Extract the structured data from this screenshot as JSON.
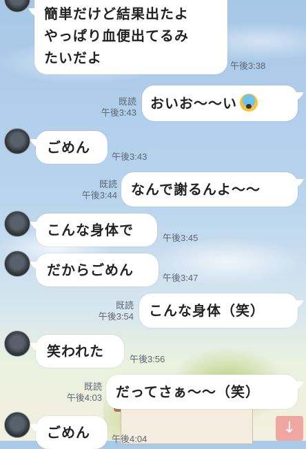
{
  "messages": [
    {
      "dir": "in",
      "text_lines": [
        "簡単だけど結果出たよ",
        "やっぱり血便出てるみ",
        "たいだよ"
      ],
      "time": "午後3:38"
    },
    {
      "dir": "out",
      "text": "おいお〜〜い",
      "emoji": "fearful-face",
      "read": "既読",
      "time": "午後3:43"
    },
    {
      "dir": "in",
      "text": "ごめん",
      "time": "午後3:43"
    },
    {
      "dir": "out",
      "text": "なんで謝るんよ〜〜",
      "read": "既読",
      "time": "午後3:44"
    },
    {
      "dir": "in",
      "text": "こんな身体で",
      "time": "午後3:45"
    },
    {
      "dir": "in",
      "text": "だからごめん",
      "time": "午後3:47"
    },
    {
      "dir": "out",
      "text": "こんな身体（笑）",
      "read": "既読",
      "time": "午後3:54"
    },
    {
      "dir": "in",
      "text": "笑われた",
      "time": "午後3:56"
    },
    {
      "dir": "out",
      "text": "だってさぁ〜〜（笑）",
      "read": "既読",
      "time": "午後4:03"
    },
    {
      "dir": "in",
      "text": "ごめん",
      "time": "午後4:04"
    }
  ],
  "scroll_button": {
    "icon": "arrow-down-icon",
    "glyph": "↓"
  },
  "colors": {
    "bubble": "#ffffff",
    "scroll_button": "#f0a6a1",
    "meta_text": "#5d6773"
  }
}
